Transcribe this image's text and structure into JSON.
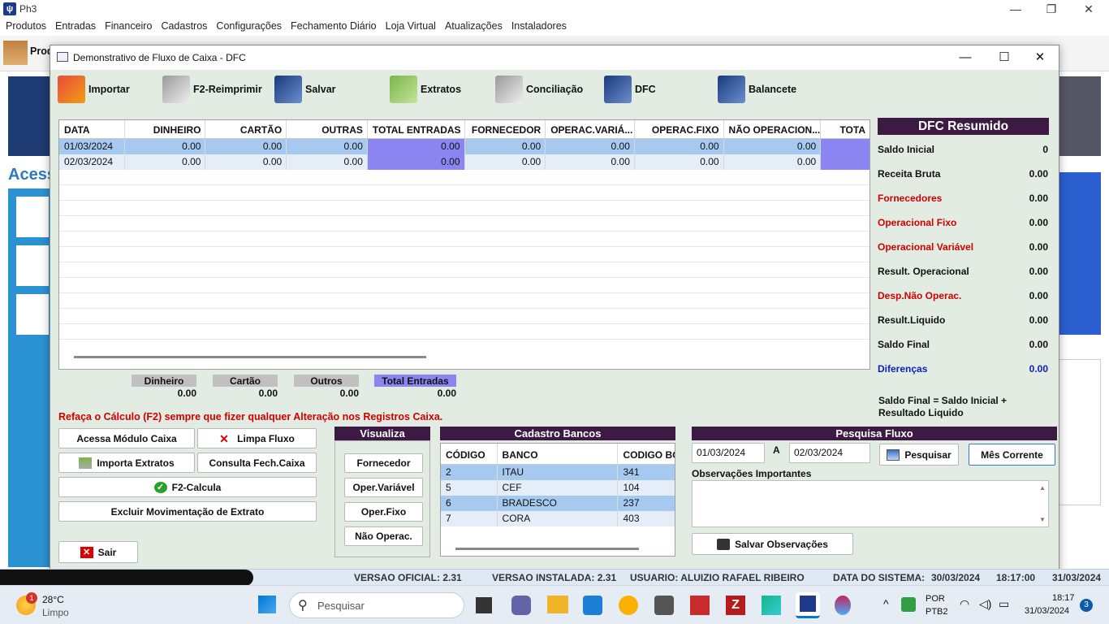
{
  "window": {
    "title": "Ph3",
    "logo": "Ph3-logo"
  },
  "menu": [
    "Produtos",
    "Entradas",
    "Financeiro",
    "Cadastros",
    "Configurações",
    "Fechamento Diário",
    "Loja Virtual",
    "Atualizações",
    "Instaladores"
  ],
  "bg": {
    "prod_label": "Prod",
    "acesso": "Acess"
  },
  "dialog": {
    "title": "Demonstrativo de Fluxo de Caixa - DFC",
    "toolbar": {
      "importar": "Importar",
      "reimprimir": "F2-Reimprimir",
      "salvar": "Salvar",
      "extratos": "Extratos",
      "conciliacao": "Conciliação",
      "dfc": "DFC",
      "balancete": "Balancete"
    },
    "grid": {
      "headers": [
        "DATA",
        "DINHEIRO",
        "CARTÃO",
        "OUTRAS",
        "TOTAL ENTRADAS",
        "FORNECEDOR",
        "OPERAC.VARIÁ...",
        "OPERAC.FIXO",
        "NÃO OPERACION...",
        "TOTA"
      ],
      "rows": [
        [
          "01/03/2024",
          "0.00",
          "0.00",
          "0.00",
          "0.00",
          "0.00",
          "0.00",
          "0.00",
          "0.00",
          ""
        ],
        [
          "02/03/2024",
          "0.00",
          "0.00",
          "0.00",
          "0.00",
          "0.00",
          "0.00",
          "0.00",
          "0.00",
          ""
        ]
      ]
    },
    "totals": {
      "dinheiro_label": "Dinheiro",
      "dinheiro": "0.00",
      "cartao_label": "Cartão",
      "cartao": "0.00",
      "outros_label": "Outros",
      "outros": "0.00",
      "total_label": "Total Entradas",
      "total": "0.00"
    },
    "summary": {
      "title": "DFC Resumido",
      "rows": [
        {
          "label": "Saldo Inicial",
          "value": "0"
        },
        {
          "label": "Receita Bruta",
          "value": "0.00"
        },
        {
          "label": "Fornecedores",
          "value": "0.00"
        },
        {
          "label": "Operacional Fixo",
          "value": "0.00"
        },
        {
          "label": "Operacional Variável",
          "value": "0.00"
        },
        {
          "label": "Result. Operacional",
          "value": "0.00"
        },
        {
          "label": "Desp.Não Operac.",
          "value": "0.00"
        },
        {
          "label": "Result.Liquido",
          "value": "0.00"
        },
        {
          "label": "Saldo Final",
          "value": "0.00"
        },
        {
          "label": "Diferenças",
          "value": "0.00"
        }
      ],
      "formula_line1": "Saldo Final = Saldo Inicial +",
      "formula_line2": "Resultado Liquido"
    },
    "warning": "Refaça o Cálculo (F2) sempre que fizer qualquer Alteração nos Registros Caixa.",
    "buttons": {
      "modulo_caixa": "Acessa Módulo Caixa",
      "limpa_fluxo": "Limpa Fluxo",
      "importa_extratos": "Importa Extratos",
      "consulta_fech": "Consulta Fech.Caixa",
      "calcula": "F2-Calcula",
      "excluir": "Excluir Movimentação de Extrato",
      "sair": "Sair"
    },
    "visualiza": {
      "title": "Visualiza",
      "fornecedor": "Fornecedor",
      "oper_variavel": "Oper.Variável",
      "oper_fixo": "Oper.Fixo",
      "nao_operac": "Não Operac."
    },
    "bancos": {
      "title": "Cadastro Bancos",
      "headers": [
        "CÓDIGO",
        "BANCO",
        "CODIGO BC"
      ],
      "rows": [
        [
          "2",
          "ITAU",
          "341"
        ],
        [
          "5",
          "CEF",
          "104"
        ],
        [
          "6",
          "BRADESCO",
          "237"
        ],
        [
          "7",
          "CORA",
          "403"
        ]
      ]
    },
    "pesquisa": {
      "title": "Pesquisa Fluxo",
      "data_inicial": "01/03/2024",
      "sep": "A",
      "data_final": "02/03/2024",
      "pesquisar": "Pesquisar",
      "mes_corrente": "Mês Corrente",
      "obs_label": "Observações Importantes",
      "salvar_obs": "Salvar Observações"
    }
  },
  "status": {
    "versao_oficial": "VERSAO OFICIAL: 2.31",
    "versao_instalada": "VERSAO INSTALADA: 2.31",
    "usuario": "USUARIO: ALUIZIO RAFAEL RIBEIRO",
    "data_sistema_label": "DATA DO SISTEMA:",
    "data_sistema": "30/03/2024",
    "hora": "18:17:00",
    "data": "31/03/2024"
  },
  "taskbar": {
    "temp": "28°C",
    "weather": "Limpo",
    "weather_badge": "1",
    "search": "Pesquisar",
    "lang1": "POR",
    "lang2": "PTB2",
    "time": "18:17",
    "date": "31/03/2024",
    "notif": "3"
  }
}
